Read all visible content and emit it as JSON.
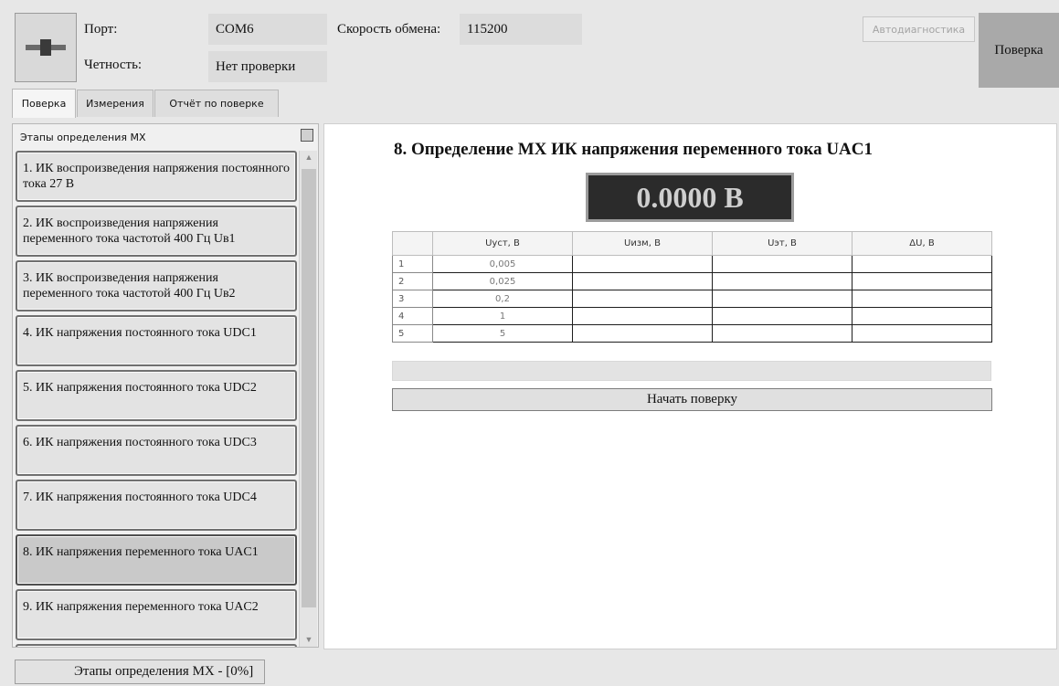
{
  "connection": {
    "port_label": "Порт:",
    "port_value": "COM6",
    "parity_label": "Четность:",
    "parity_value": "Нет проверки",
    "speed_label": "Скорость обмена:",
    "speed_value": "115200",
    "icon": "connector-icon"
  },
  "toolbar": {
    "autodiag_label": "Автодиагностика",
    "verify_label": "Поверка"
  },
  "tabs": [
    {
      "label": "Поверка",
      "active": true
    },
    {
      "label": "Измерения",
      "active": false
    },
    {
      "label": "Отчёт по поверке",
      "active": false
    }
  ],
  "stages": {
    "title": "Этапы определения МХ",
    "items": [
      {
        "label": "1. ИК воспроизведения напряжения постоянного тока 27 В"
      },
      {
        "label": "2. ИК воспроизведения напряжения переменного тока частотой 400 Гц Uв1"
      },
      {
        "label": "3. ИК воспроизведения напряжения переменного тока частотой 400 Гц Uв2"
      },
      {
        "label": "4. ИК напряжения постоянного тока UDC1"
      },
      {
        "label": "5. ИК напряжения постоянного тока UDC2"
      },
      {
        "label": "6. ИК напряжения постоянного тока UDC3"
      },
      {
        "label": "7. ИК напряжения постоянного тока UDC4"
      },
      {
        "label": "8. ИК напряжения переменного тока UAC1",
        "selected": true
      },
      {
        "label": "9. ИК напряжения переменного тока UAC2"
      }
    ]
  },
  "status": {
    "text": "Этапы определения МХ - [0%]"
  },
  "main": {
    "title": "8. Определение МХ ИК напряжения переменного тока UAC1",
    "display_value": "0.0000 В",
    "table": {
      "columns": [
        "",
        "Uуст, В",
        "Uизм, В",
        "Uэт, В",
        "ΔU, В"
      ],
      "rows": [
        [
          "1",
          "0,005",
          "",
          "",
          ""
        ],
        [
          "2",
          "0,025",
          "",
          "",
          ""
        ],
        [
          "3",
          "0,2",
          "",
          "",
          ""
        ],
        [
          "4",
          "1",
          "",
          "",
          ""
        ],
        [
          "5",
          "5",
          "",
          "",
          ""
        ]
      ]
    },
    "progress_fraction": 0,
    "start_button_label": "Начать поверку"
  }
}
